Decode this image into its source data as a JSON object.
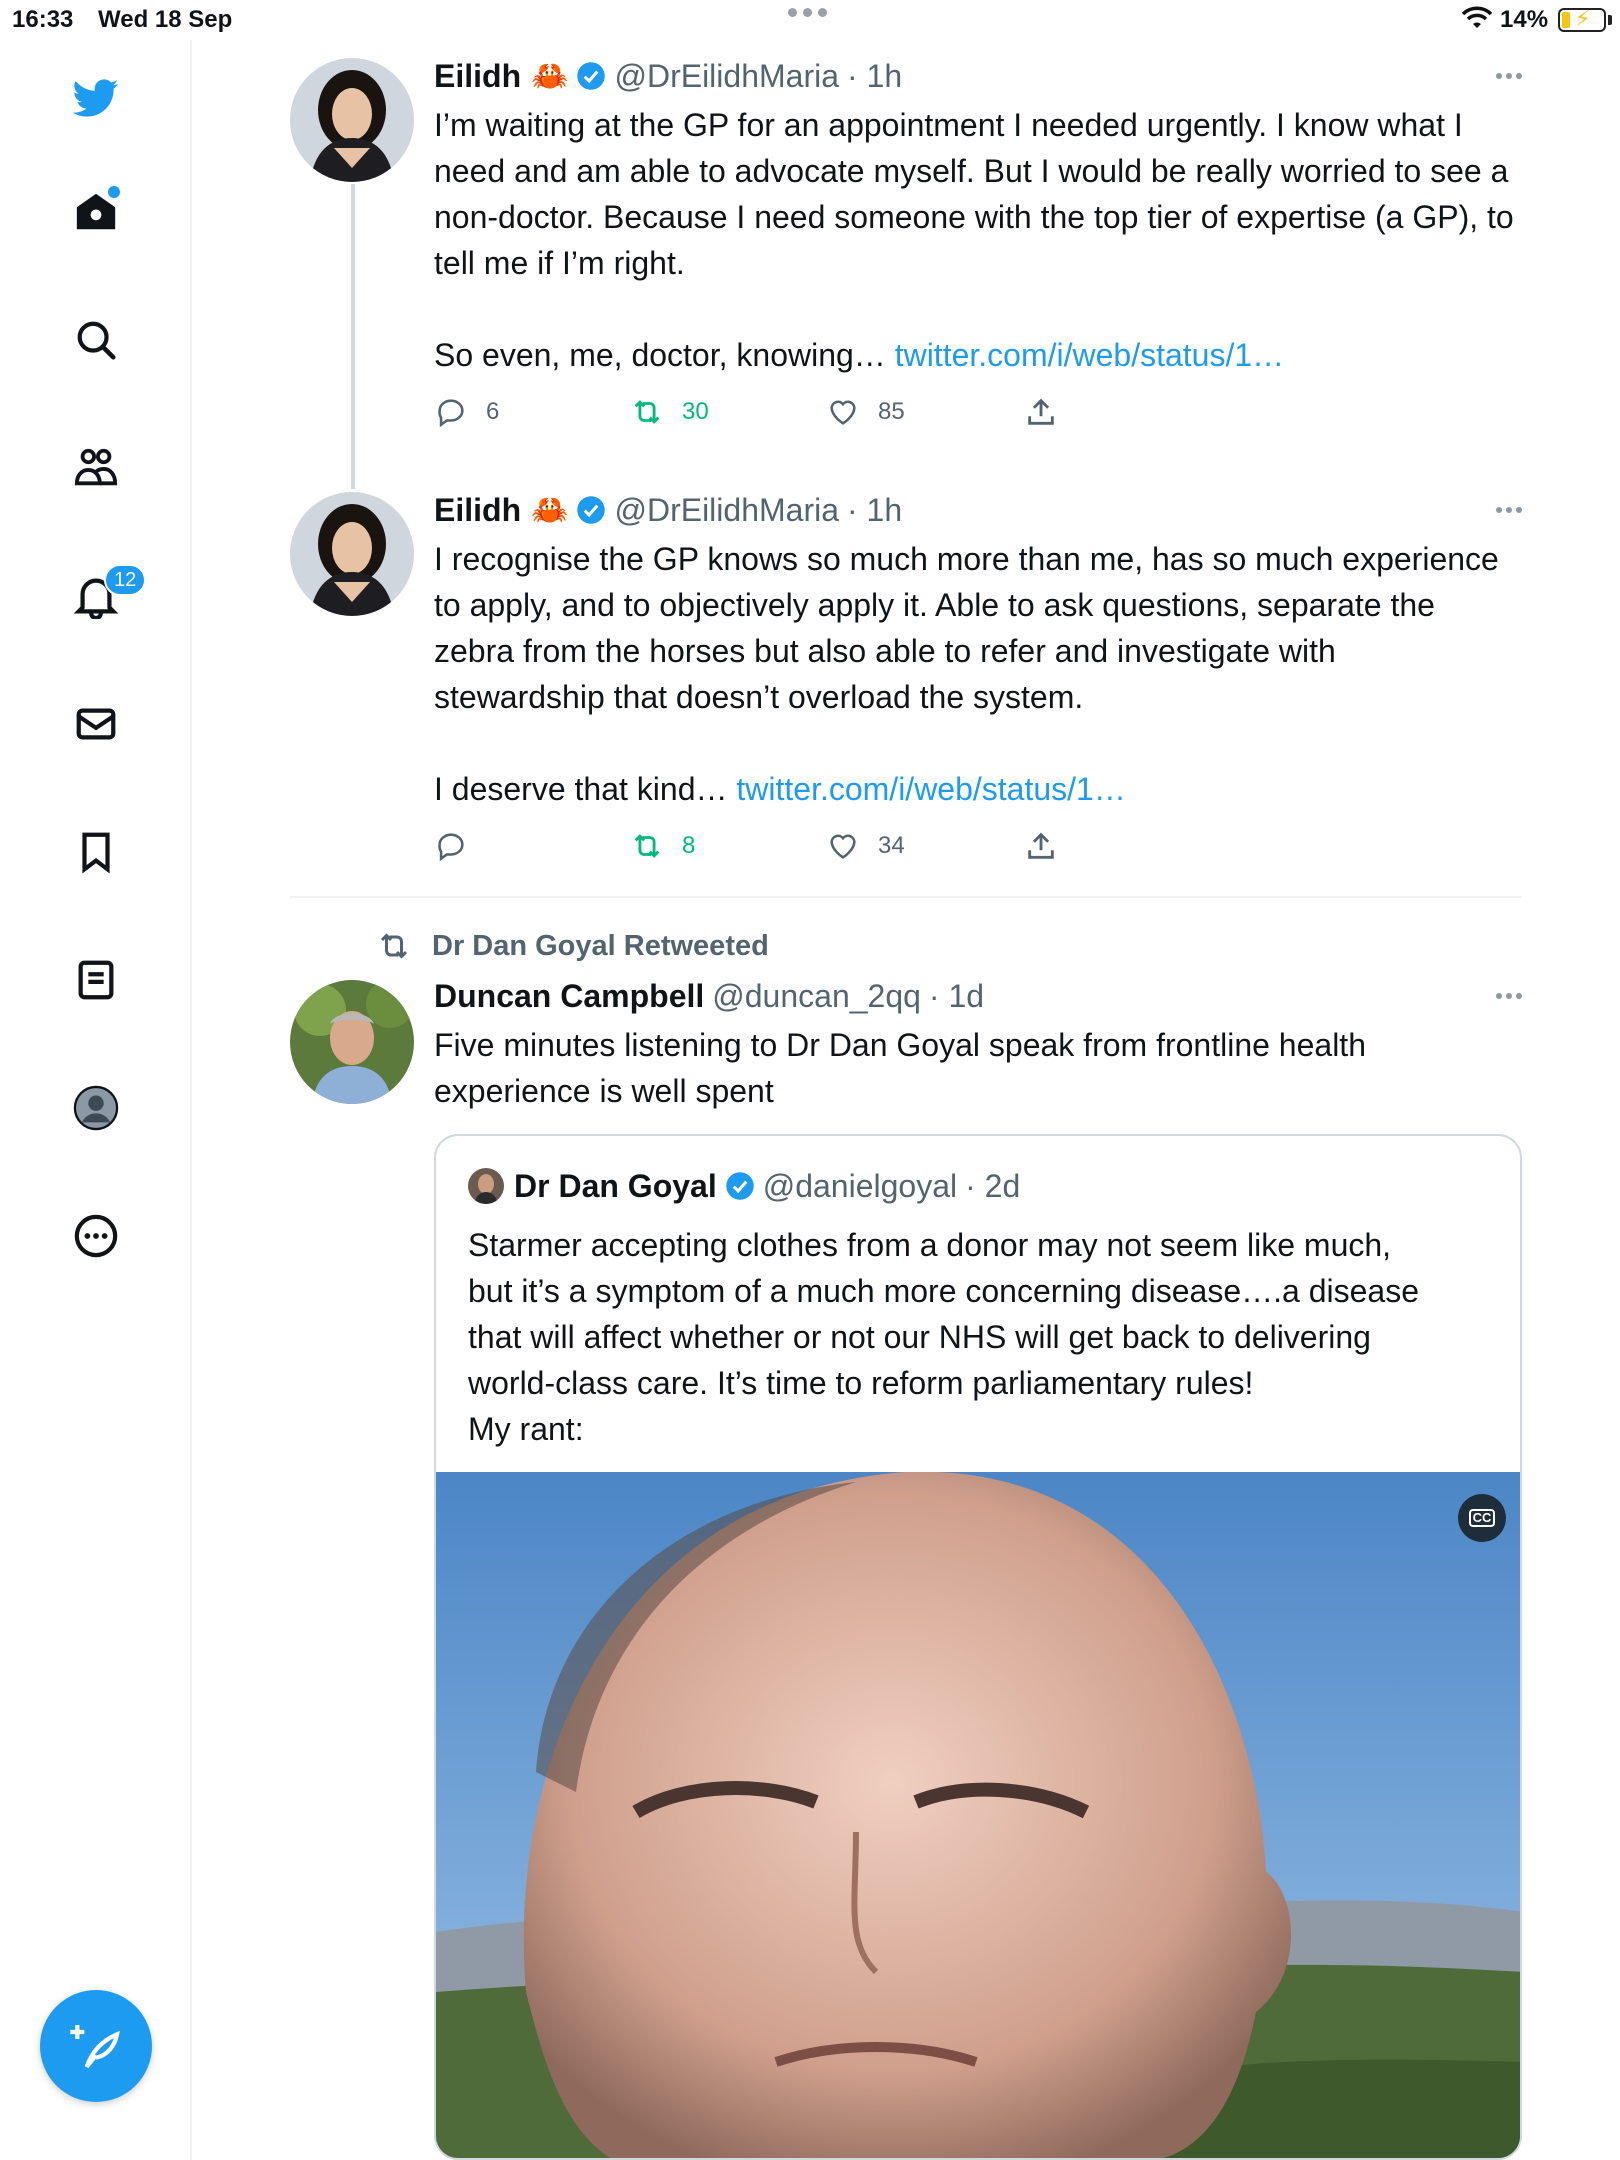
{
  "status_bar": {
    "time": "16:33",
    "date": "Wed 18 Sep",
    "battery": "14%"
  },
  "sidebar": {
    "items": [
      {
        "name": "twitter-logo"
      },
      {
        "name": "home"
      },
      {
        "name": "explore"
      },
      {
        "name": "communities"
      },
      {
        "name": "notifications",
        "badge": "12"
      },
      {
        "name": "messages"
      },
      {
        "name": "bookmarks"
      },
      {
        "name": "lists"
      },
      {
        "name": "profile"
      },
      {
        "name": "more"
      }
    ]
  },
  "tweets": [
    {
      "name": "Eilidh",
      "emoji": "🦀",
      "handle": "@DrEilidhMaria",
      "time": "· 1h",
      "paragraph1": "I’m waiting at the GP for an appointment I needed urgently. I know what I need and am able to advocate myself. But I would be really worried to see a non-doctor. Because I need someone with the top tier of expertise (a GP), to tell me if I’m right.",
      "paragraph2": "So even, me, doctor, knowing…",
      "link": "twitter.com/i/web/status/1…",
      "replies": "6",
      "retweets": "30",
      "likes": "85"
    },
    {
      "name": "Eilidh",
      "emoji": "🦀",
      "handle": "@DrEilidhMaria",
      "time": "· 1h",
      "paragraph1": "I recognise the GP knows so much more than me, has so much experience to apply, and to objectively apply it. Able to ask questions, separate the zebra from the horses but also able to refer and investigate with stewardship that doesn’t overload the system.",
      "paragraph2": "I deserve that kind…",
      "link": "twitter.com/i/web/status/1…",
      "replies": "",
      "retweets": "8",
      "likes": "34"
    },
    {
      "retweeted_by": "Dr Dan Goyal Retweeted",
      "name": "Duncan Campbell",
      "handle": "@duncan_2qq",
      "time": "· 1d",
      "text": "Five minutes listening to Dr Dan Goyal speak from frontline health experience is well spent",
      "quote": {
        "name": "Dr Dan Goyal",
        "handle": "@danielgoyal",
        "time": "· 2d",
        "lines": [
          "Starmer accepting clothes from a donor may not seem like much,",
          "but it’s a symptom of a much more concerning disease….a disease",
          "that will affect whether or not our NHS will get back to delivering",
          "world-class care. It’s time to reform parliamentary rules!",
          "My rant:"
        ],
        "cc_label": "CC"
      }
    }
  ],
  "colors": {
    "accent": "#1d9bf0",
    "retweet": "#00ba7c",
    "secondary": "#536471"
  }
}
